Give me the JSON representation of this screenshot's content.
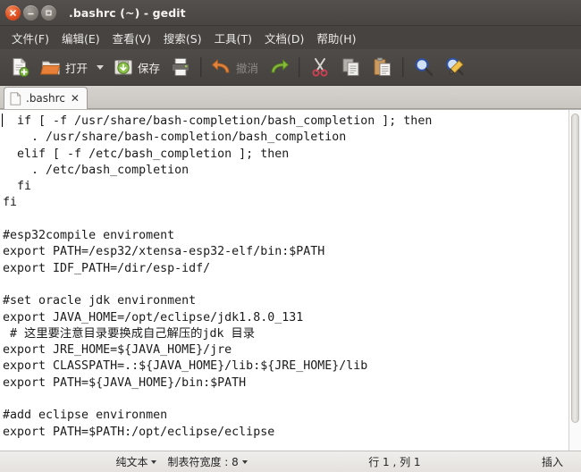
{
  "window": {
    "title": ".bashrc (~) - gedit",
    "controls": [
      {
        "name": "close",
        "label": "×"
      },
      {
        "name": "minimize",
        "label": "–"
      },
      {
        "name": "maximize",
        "label": "□"
      }
    ]
  },
  "menubar": {
    "items": [
      {
        "label": "文件(F)",
        "name": "menu-file"
      },
      {
        "label": "编辑(E)",
        "name": "menu-edit"
      },
      {
        "label": "查看(V)",
        "name": "menu-view"
      },
      {
        "label": "搜索(S)",
        "name": "menu-search"
      },
      {
        "label": "工具(T)",
        "name": "menu-tools"
      },
      {
        "label": "文档(D)",
        "name": "menu-documents"
      },
      {
        "label": "帮助(H)",
        "name": "menu-help"
      }
    ]
  },
  "toolbar": {
    "new_label": "",
    "open_label": "打开",
    "save_label": "保存",
    "print_label": "",
    "undo_label": "撤消",
    "redo_label": "",
    "cut_label": "",
    "copy_label": "",
    "paste_label": "",
    "find_label": "",
    "replace_label": ""
  },
  "tabs": [
    {
      "label": ".bashrc",
      "close": "✕",
      "active": true
    }
  ],
  "editor": {
    "lines": [
      "  if [ -f /usr/share/bash-completion/bash_completion ]; then",
      "    . /usr/share/bash-completion/bash_completion",
      "  elif [ -f /etc/bash_completion ]; then",
      "    . /etc/bash_completion",
      "  fi",
      "fi",
      "",
      "#esp32compile enviroment",
      "export PATH=/esp32/xtensa-esp32-elf/bin:$PATH",
      "export IDF_PATH=/dir/esp-idf/",
      "",
      "#set oracle jdk environment",
      "export JAVA_HOME=/opt/eclipse/jdk1.8.0_131",
      " # 这里要注意目录要换成自己解压的jdk 目录",
      "export JRE_HOME=${JAVA_HOME}/jre",
      "export CLASSPATH=.:${JAVA_HOME}/lib:${JRE_HOME}/lib",
      "export PATH=${JAVA_HOME}/bin:$PATH",
      "",
      "#add eclipse environmen",
      "export PATH=$PATH:/opt/eclipse/eclipse"
    ]
  },
  "statusbar": {
    "language": "纯文本",
    "tabwidth": "制表符宽度 : 8",
    "position": "行 1 , 列 1",
    "mode": "插入"
  },
  "colors": {
    "chrome": "#4a4846",
    "titlebar_text": "#f4f2f0",
    "editor_bg": "#ffffff",
    "editor_text": "#1b1b1b",
    "close_button": "#df4f20"
  }
}
